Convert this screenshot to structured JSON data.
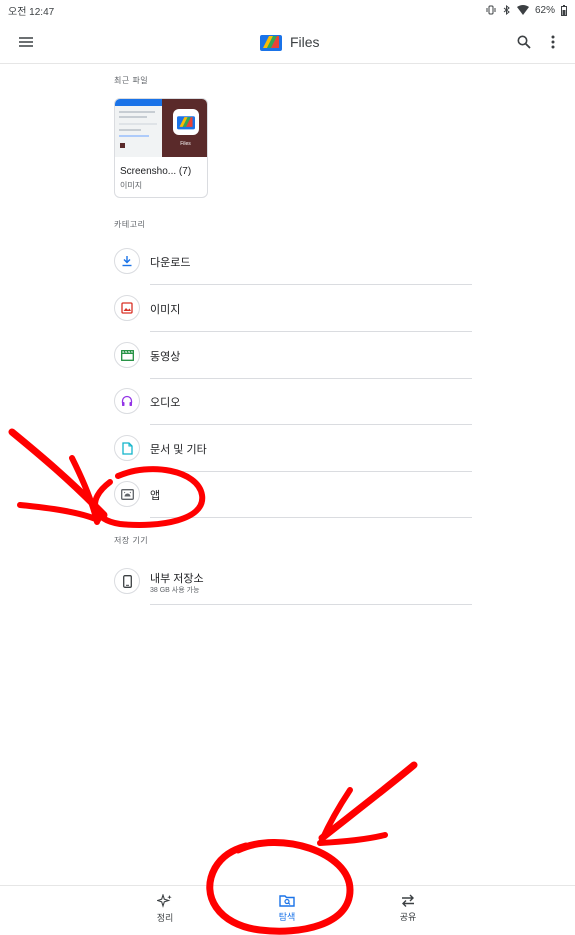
{
  "status_bar": {
    "time": "오전 12:47",
    "battery": "62%"
  },
  "app_bar": {
    "title": "Files"
  },
  "recent": {
    "section_label": "최근 파일",
    "items": [
      {
        "name": "Screensho... (7)",
        "type": "이미지",
        "thumb_label": "Files"
      }
    ]
  },
  "categories": {
    "section_label": "카테고리",
    "items": [
      {
        "label": "다운로드",
        "icon": "download-icon",
        "color": "#1a73e8"
      },
      {
        "label": "이미지",
        "icon": "image-icon",
        "color": "#d93025"
      },
      {
        "label": "동영상",
        "icon": "video-icon",
        "color": "#1e8e3e"
      },
      {
        "label": "오디오",
        "icon": "headphones-icon",
        "color": "#9334e6"
      },
      {
        "label": "문서 및 기타",
        "icon": "document-icon",
        "color": "#12b5cb"
      },
      {
        "label": "앱",
        "icon": "android-icon",
        "color": "#5f6368"
      }
    ]
  },
  "storage": {
    "section_label": "저장 기기",
    "items": [
      {
        "label": "내부 저장소",
        "sub": "38 GB 사용 가능",
        "icon": "phone-icon"
      }
    ]
  },
  "bottom_nav": {
    "items": [
      {
        "label": "정리",
        "icon": "sparkle-icon",
        "active": false
      },
      {
        "label": "탐색",
        "icon": "browse-icon",
        "active": true
      },
      {
        "label": "공유",
        "icon": "swap-icon",
        "active": false
      }
    ]
  },
  "colors": {
    "accent": "#1a73e8",
    "annotation": "#ff0000"
  }
}
